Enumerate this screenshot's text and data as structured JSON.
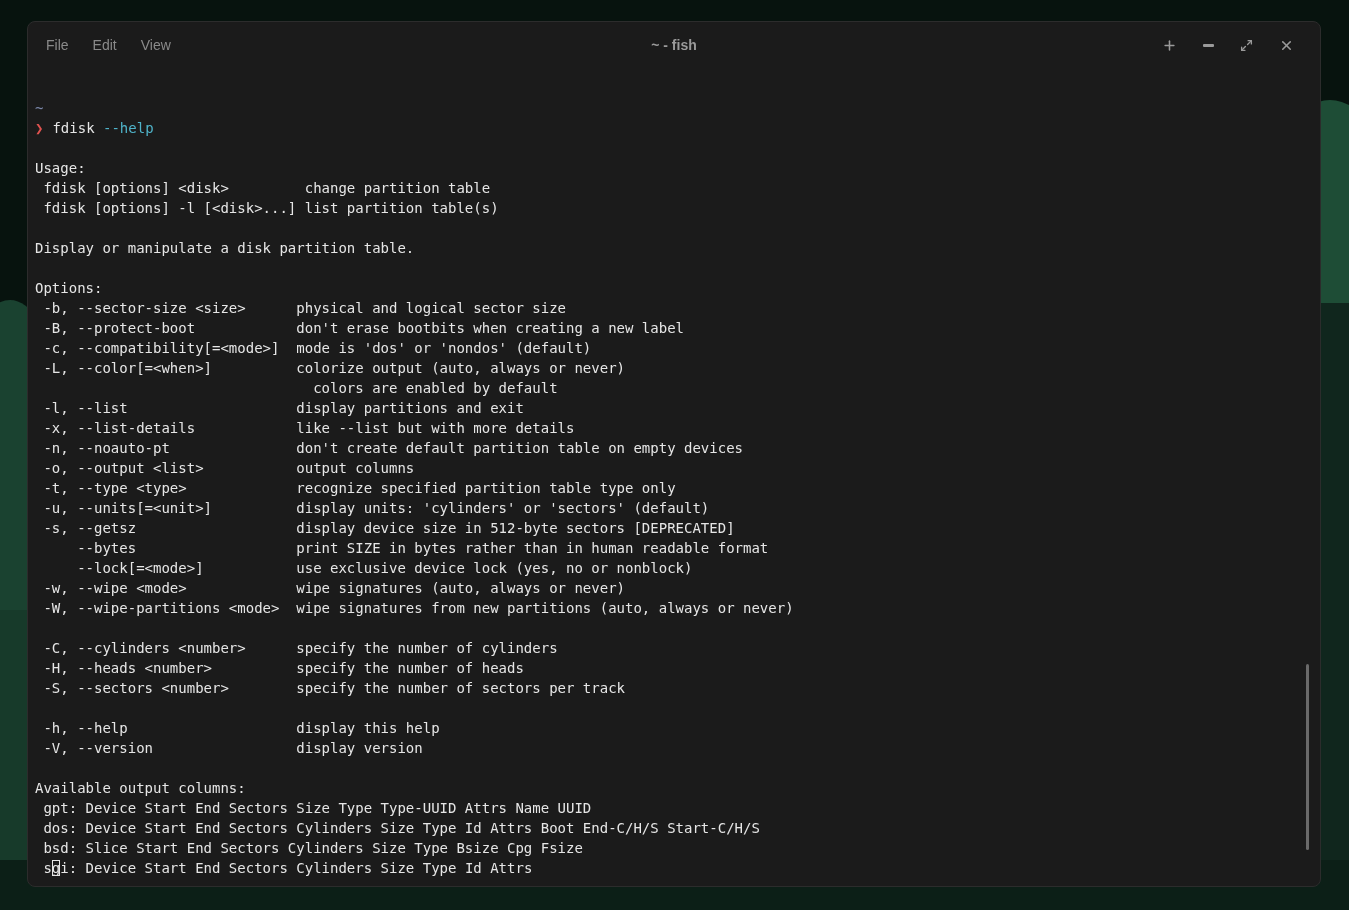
{
  "window": {
    "title": "~ - fish",
    "menu": [
      "File",
      "Edit",
      "View"
    ]
  },
  "terminal": {
    "lines": [
      {
        "kind": "blank"
      },
      {
        "kind": "cwd",
        "text": "~"
      },
      {
        "kind": "prompt",
        "symbol": "❯",
        "command": "fdisk",
        "argument": "--help"
      },
      {
        "kind": "blank"
      },
      {
        "kind": "plain",
        "text": "Usage:"
      },
      {
        "kind": "plain",
        "text": " fdisk [options] <disk>         change partition table"
      },
      {
        "kind": "plain",
        "text": " fdisk [options] -l [<disk>...] list partition table(s)"
      },
      {
        "kind": "blank"
      },
      {
        "kind": "plain",
        "text": "Display or manipulate a disk partition table."
      },
      {
        "kind": "blank"
      },
      {
        "kind": "plain",
        "text": "Options:"
      },
      {
        "kind": "plain",
        "text": " -b, --sector-size <size>      physical and logical sector size"
      },
      {
        "kind": "plain",
        "text": " -B, --protect-boot            don't erase bootbits when creating a new label"
      },
      {
        "kind": "plain",
        "text": " -c, --compatibility[=<mode>]  mode is 'dos' or 'nondos' (default)"
      },
      {
        "kind": "plain",
        "text": " -L, --color[=<when>]          colorize output (auto, always or never)"
      },
      {
        "kind": "plain",
        "text": "                                 colors are enabled by default"
      },
      {
        "kind": "plain",
        "text": " -l, --list                    display partitions and exit"
      },
      {
        "kind": "plain",
        "text": " -x, --list-details            like --list but with more details"
      },
      {
        "kind": "plain",
        "text": " -n, --noauto-pt               don't create default partition table on empty devices"
      },
      {
        "kind": "plain",
        "text": " -o, --output <list>           output columns"
      },
      {
        "kind": "plain",
        "text": " -t, --type <type>             recognize specified partition table type only"
      },
      {
        "kind": "plain",
        "text": " -u, --units[=<unit>]          display units: 'cylinders' or 'sectors' (default)"
      },
      {
        "kind": "plain",
        "text": " -s, --getsz                   display device size in 512-byte sectors [DEPRECATED]"
      },
      {
        "kind": "plain",
        "text": "     --bytes                   print SIZE in bytes rather than in human readable format"
      },
      {
        "kind": "plain",
        "text": "     --lock[=<mode>]           use exclusive device lock (yes, no or nonblock)"
      },
      {
        "kind": "plain",
        "text": " -w, --wipe <mode>             wipe signatures (auto, always or never)"
      },
      {
        "kind": "plain",
        "text": " -W, --wipe-partitions <mode>  wipe signatures from new partitions (auto, always or never)"
      },
      {
        "kind": "blank"
      },
      {
        "kind": "plain",
        "text": " -C, --cylinders <number>      specify the number of cylinders"
      },
      {
        "kind": "plain",
        "text": " -H, --heads <number>          specify the number of heads"
      },
      {
        "kind": "plain",
        "text": " -S, --sectors <number>        specify the number of sectors per track"
      },
      {
        "kind": "blank"
      },
      {
        "kind": "plain",
        "text": " -h, --help                    display this help"
      },
      {
        "kind": "plain",
        "text": " -V, --version                 display version"
      },
      {
        "kind": "blank"
      },
      {
        "kind": "plain",
        "text": "Available output columns:"
      },
      {
        "kind": "plain",
        "text": " gpt: Device Start End Sectors Size Type Type-UUID Attrs Name UUID"
      },
      {
        "kind": "plain",
        "text": " dos: Device Start End Sectors Cylinders Size Type Id Attrs Boot End-C/H/S Start-C/H/S"
      },
      {
        "kind": "plain",
        "text": " bsd: Slice Start End Sectors Cylinders Size Type Bsize Cpg Fsize"
      },
      {
        "kind": "cursor",
        "before": " s",
        "cursor": "g",
        "after": "i: Device Start End Sectors Cylinders Size Type Id Attrs"
      }
    ]
  }
}
